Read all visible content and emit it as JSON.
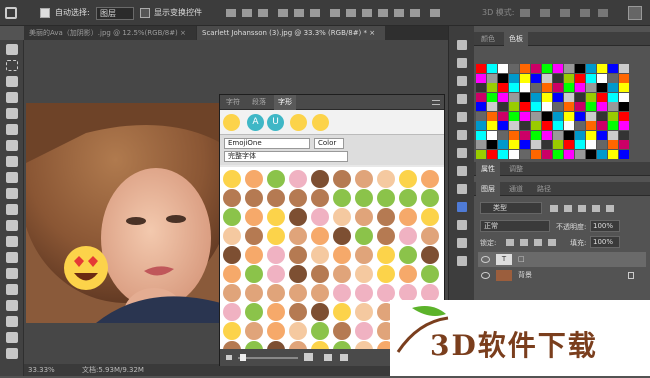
{
  "options_bar": {
    "auto_select_label": "自动选择:",
    "auto_select_value": "图层",
    "show_transform_label": "显示变换控件",
    "mode3d_label": "3D 模式:"
  },
  "doc_tabs": [
    {
      "title": "美丽的Ava（加阴影）.jpg @ 12.5%(RGB/8#)",
      "active": false
    },
    {
      "title": "Scarlett Johansson (3).jpg @ 33.3% (RGB/8#) *",
      "active": true
    }
  ],
  "status_bar": {
    "zoom": "33.33%",
    "doc_info": "文档:5.93M/9.32M"
  },
  "glyphs_panel": {
    "tabs": [
      "字符",
      "段落",
      "字形"
    ],
    "active_tab": "字形",
    "font_value": "EmojiOne",
    "style_value": "Color",
    "filter_value": "完整字体",
    "recent_labels": [
      "A",
      "U"
    ]
  },
  "swatches_panel": {
    "tabs": [
      "颜色",
      "色板"
    ],
    "active_tab": "色板"
  },
  "properties_panel": {
    "tabs": [
      "属性",
      "调整"
    ],
    "active_tab": "属性"
  },
  "layers_panel": {
    "tabs": [
      "图层",
      "通道",
      "路径"
    ],
    "active_tab": "图层",
    "filter_label": "类型",
    "blend_mode": "正常",
    "opacity_label": "不透明度:",
    "opacity_value": "100%",
    "lock_label": "锁定:",
    "fill_label": "填充:",
    "fill_value": "100%",
    "layers": [
      {
        "name": "□",
        "type": "text",
        "selected": true
      },
      {
        "name": "背景",
        "type": "image",
        "selected": false
      }
    ]
  },
  "watermark": {
    "text": "3D软件下载"
  }
}
